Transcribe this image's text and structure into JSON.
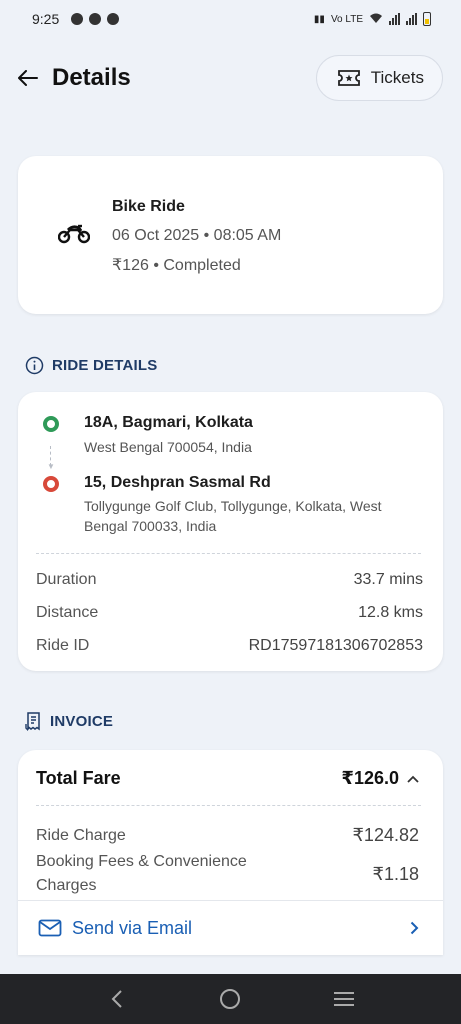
{
  "status_bar": {
    "time": "9:25",
    "network": "Vo LTE"
  },
  "header": {
    "title": "Details",
    "tickets_label": "Tickets"
  },
  "ride": {
    "title": "Bike Ride",
    "datetime": "06 Oct 2025 • 08:05 AM",
    "summary": "₹126 • Completed"
  },
  "ride_details": {
    "section_label": "RIDE DETAILS",
    "from": {
      "title": "18A, Bagmari, Kolkata",
      "address": "West Bengal 700054, India"
    },
    "to": {
      "title": "15, Deshpran Sasmal Rd",
      "address": "Tollygunge Golf Club, Tollygunge, Kolkata, West Bengal 700033, India"
    },
    "rows": [
      {
        "label": "Duration",
        "value": "33.7 mins"
      },
      {
        "label": "Distance",
        "value": "12.8 kms"
      },
      {
        "label": "Ride ID",
        "value": "RD17597181306702853"
      }
    ]
  },
  "invoice": {
    "section_label": "INVOICE",
    "total_label": "Total Fare",
    "total_value": "₹126.0",
    "items": [
      {
        "label": "Ride Charge",
        "value": "₹124.82"
      },
      {
        "label": "Booking Fees & Convenience Charges",
        "value": "₹1.18"
      }
    ],
    "email_label": "Send via Email"
  },
  "colors": {
    "accent": "#1a5fb4",
    "section_heading": "#1f3b66",
    "pickup": "#2f9a58",
    "drop": "#d8493a",
    "background": "#eef2f8"
  }
}
